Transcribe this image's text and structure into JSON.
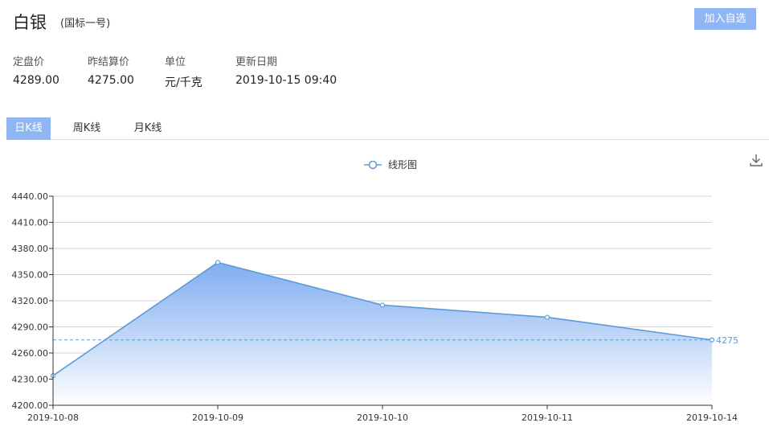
{
  "header": {
    "title": "白银",
    "subtitle": "(国标一号)",
    "add_button": "加入自选"
  },
  "stats": [
    {
      "label": "定盘价",
      "value": "4289.00"
    },
    {
      "label": "昨结算价",
      "value": "4275.00"
    },
    {
      "label": "单位",
      "value": "元/千克"
    },
    {
      "label": "更新日期",
      "value": "2019-10-15 09:40"
    }
  ],
  "tabs": [
    {
      "label": "日K线",
      "active": true
    },
    {
      "label": "周K线",
      "active": false
    },
    {
      "label": "月K线",
      "active": false
    }
  ],
  "colors": {
    "accent": "#8fb6f3",
    "line": "#5b9bd5",
    "area_top": "#7aa9f0",
    "area_bottom": "#ffffff"
  },
  "icons": {
    "download": "download-icon"
  },
  "chart_data": {
    "type": "area",
    "legend": "线形图",
    "legend_position": "top-center",
    "categories": [
      "2019-10-08",
      "2019-10-09",
      "2019-10-10",
      "2019-10-11",
      "2019-10-14"
    ],
    "values": [
      4234,
      4364,
      4315,
      4301,
      4275
    ],
    "yticks": [
      "4200.00",
      "4230.00",
      "4260.00",
      "4290.00",
      "4320.00",
      "4350.00",
      "4380.00",
      "4410.00",
      "4440.00"
    ],
    "ylim": [
      4200,
      4440
    ],
    "grid": true,
    "mark_line": {
      "value": 4275,
      "label": "4275"
    }
  }
}
